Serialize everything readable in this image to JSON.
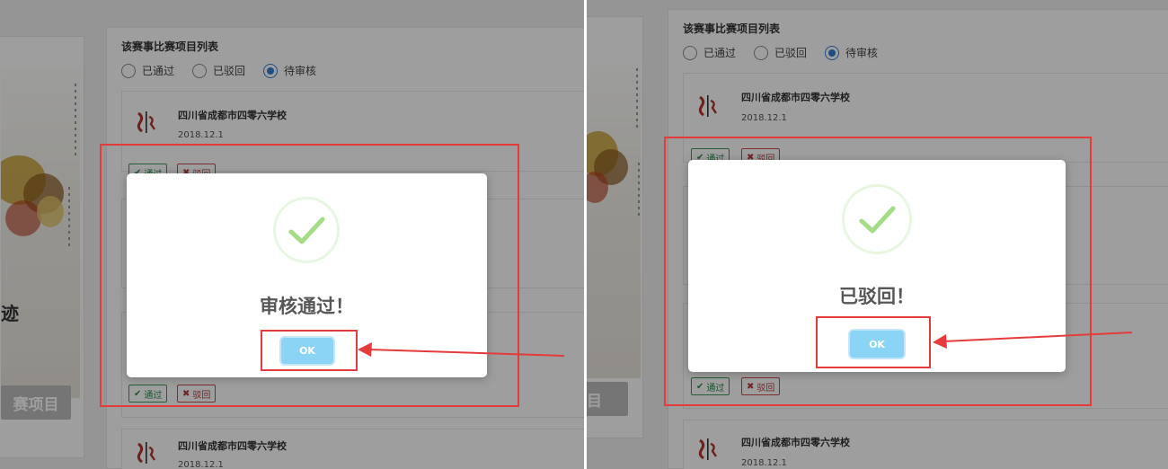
{
  "section_title": "该赛事比赛项目列表",
  "filter": {
    "options": [
      "已通过",
      "已驳回",
      "待审核"
    ],
    "selected": "待审核"
  },
  "school": {
    "name": "四川省成都市四零六学校",
    "date": "2018.12.1"
  },
  "actions": {
    "pass_label": "通过",
    "reject_label": "驳回"
  },
  "left_panel": {
    "dialog_message": "审核通过！",
    "ok_label": "OK",
    "side_button": "赛项目",
    "poster_glyph": "迹"
  },
  "right_panel": {
    "dialog_message": "已驳回！",
    "ok_label": "OK",
    "side_button": "目"
  },
  "colors": {
    "highlight_red": "#e53b3b",
    "success_green": "#a5dc86",
    "ok_blue": "#8cd4f5",
    "radio_blue": "#2e7fd6",
    "pass_green": "#2f8a4c",
    "reject_red": "#b73a3a"
  }
}
